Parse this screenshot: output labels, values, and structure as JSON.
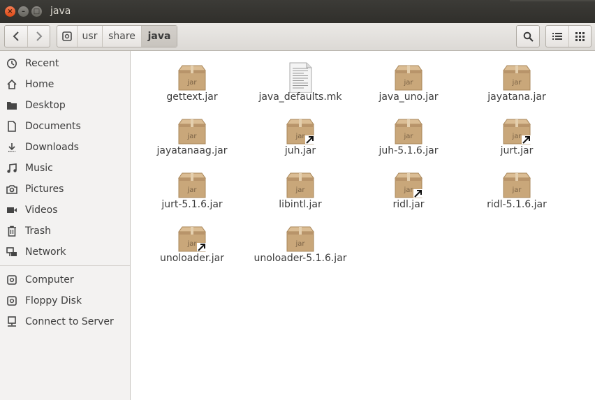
{
  "window": {
    "title": "java",
    "close_glyph": "×",
    "minimize_glyph": "–",
    "maximize_glyph": "□"
  },
  "toolbar": {
    "back_icon": "chevron-left-icon",
    "forward_icon": "chevron-right-icon",
    "drive_icon": "drive-icon",
    "breadcrumbs": [
      "usr",
      "share",
      "java"
    ],
    "active_crumb": "java",
    "search_icon": "search-icon",
    "list_view_icon": "list-view-icon",
    "grid_view_icon": "grid-view-icon"
  },
  "sidebar": {
    "places": [
      {
        "label": "Recent",
        "icon": "clock-icon"
      },
      {
        "label": "Home",
        "icon": "home-icon"
      },
      {
        "label": "Desktop",
        "icon": "folder-icon"
      },
      {
        "label": "Documents",
        "icon": "document-icon"
      },
      {
        "label": "Downloads",
        "icon": "download-icon"
      },
      {
        "label": "Music",
        "icon": "music-icon"
      },
      {
        "label": "Pictures",
        "icon": "camera-icon"
      },
      {
        "label": "Videos",
        "icon": "video-icon"
      },
      {
        "label": "Trash",
        "icon": "trash-icon"
      },
      {
        "label": "Network",
        "icon": "network-icon"
      }
    ],
    "devices": [
      {
        "label": "Computer",
        "icon": "drive-icon"
      },
      {
        "label": "Floppy Disk",
        "icon": "drive-icon"
      },
      {
        "label": "Connect to Server",
        "icon": "server-icon"
      }
    ]
  },
  "files": [
    {
      "name": "gettext.jar",
      "type": "jar",
      "link": false
    },
    {
      "name": "java_defaults.mk",
      "type": "text",
      "link": false
    },
    {
      "name": "java_uno.jar",
      "type": "jar",
      "link": false
    },
    {
      "name": "jayatana.jar",
      "type": "jar",
      "link": false
    },
    {
      "name": "jayatanaag.jar",
      "type": "jar",
      "link": false
    },
    {
      "name": "juh.jar",
      "type": "jar",
      "link": true
    },
    {
      "name": "juh-5.1.6.jar",
      "type": "jar",
      "link": false
    },
    {
      "name": "jurt.jar",
      "type": "jar",
      "link": true
    },
    {
      "name": "jurt-5.1.6.jar",
      "type": "jar",
      "link": false
    },
    {
      "name": "libintl.jar",
      "type": "jar",
      "link": false
    },
    {
      "name": "ridl.jar",
      "type": "jar",
      "link": true
    },
    {
      "name": "ridl-5.1.6.jar",
      "type": "jar",
      "link": false
    },
    {
      "name": "unoloader.jar",
      "type": "jar",
      "link": true
    },
    {
      "name": "unoloader-5.1.6.jar",
      "type": "jar",
      "link": false
    }
  ],
  "jar_icon_text": "jar",
  "colors": {
    "titlebar": "#3c3b37",
    "close": "#df4a16",
    "sidebar_bg": "#f3f2f1",
    "package": "#c9a77a"
  }
}
